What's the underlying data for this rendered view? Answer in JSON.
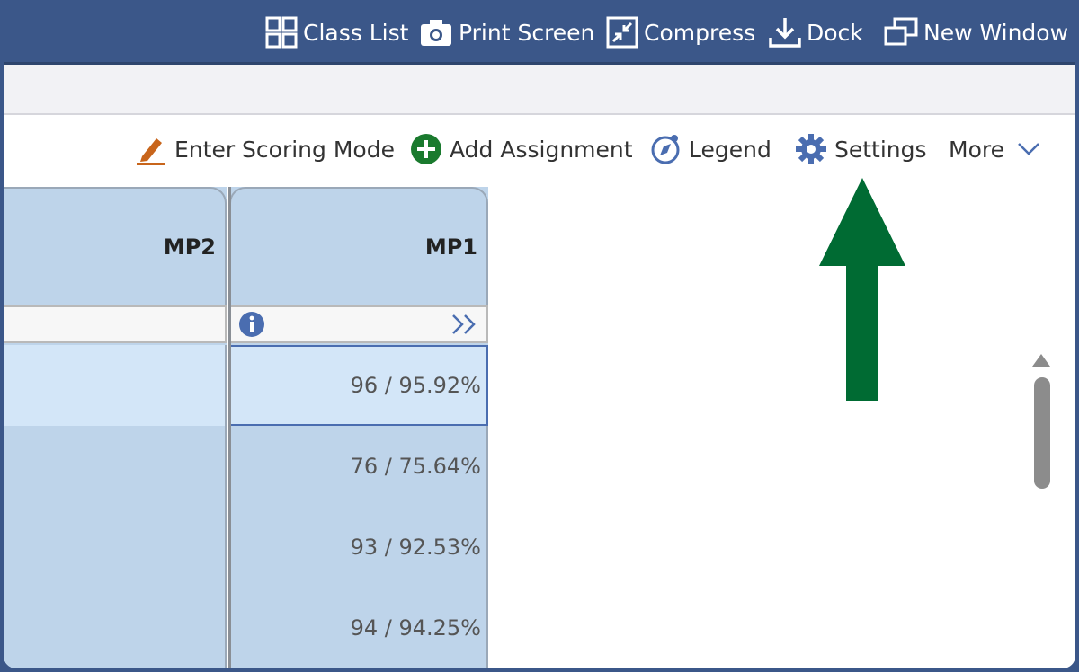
{
  "topbar": {
    "items": [
      {
        "label": "Class List",
        "icon": "grid-icon"
      },
      {
        "label": "Print Screen",
        "icon": "camera-icon"
      },
      {
        "label": "Compress",
        "icon": "compress-icon"
      },
      {
        "label": "Dock",
        "icon": "download-icon"
      },
      {
        "label": "New Window",
        "icon": "new-window-icon"
      }
    ]
  },
  "toolbar": {
    "items": [
      {
        "label": "Enter Scoring Mode",
        "icon": "pencil-icon"
      },
      {
        "label": "Add Assignment",
        "icon": "plus-circle-icon"
      },
      {
        "label": "Legend",
        "icon": "compass-icon"
      },
      {
        "label": "Settings",
        "icon": "gear-icon"
      },
      {
        "label": "More",
        "icon": "chevron-down-icon"
      }
    ]
  },
  "grid": {
    "columns": [
      {
        "header": "MP2",
        "values": [
          "",
          "",
          "",
          ""
        ]
      },
      {
        "header": "MP1",
        "values": [
          "96 / 95.92%",
          "76 / 75.64%",
          "93 / 92.53%",
          "94 / 94.25%"
        ]
      }
    ]
  },
  "colors": {
    "topbar": "#3b5789",
    "cell_selected": "#d3e6f8",
    "cell": "#bed4ea",
    "annotation_arrow": "#006b33",
    "add_icon": "#1a7a2e",
    "pencil_icon": "#c8651b",
    "blue_icon": "#4a6db0"
  }
}
